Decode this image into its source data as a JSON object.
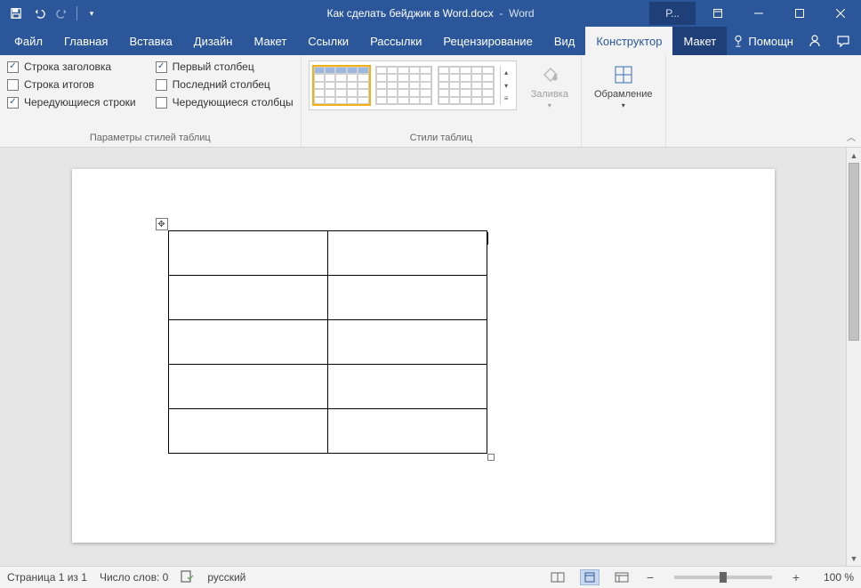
{
  "titlebar": {
    "filename": "Как сделать бейджик в Word.docx",
    "appname": "Word",
    "account_short": "Р..."
  },
  "tabs": {
    "file": "Файл",
    "items": [
      "Главная",
      "Вставка",
      "Дизайн",
      "Макет",
      "Ссылки",
      "Рассылки",
      "Рецензирование",
      "Вид"
    ],
    "context": [
      "Конструктор",
      "Макет"
    ],
    "active": "Конструктор",
    "help_label": "Помощн"
  },
  "ribbon": {
    "style_options": {
      "col1": [
        {
          "label": "Строка заголовка",
          "checked": true
        },
        {
          "label": "Строка итогов",
          "checked": false
        },
        {
          "label": "Чередующиеся строки",
          "checked": true
        }
      ],
      "col2": [
        {
          "label": "Первый столбец",
          "checked": true
        },
        {
          "label": "Последний столбец",
          "checked": false
        },
        {
          "label": "Чередующиеся столбцы",
          "checked": false
        }
      ],
      "group_label": "Параметры стилей таблиц"
    },
    "styles_group_label": "Стили таблиц",
    "shading_label": "Заливка",
    "borders_label": "Обрамление"
  },
  "document": {
    "table": {
      "rows": 5,
      "cols": 2
    }
  },
  "status": {
    "page": "Страница 1 из 1",
    "words": "Число слов: 0",
    "language": "русский",
    "zoom": "100 %"
  }
}
